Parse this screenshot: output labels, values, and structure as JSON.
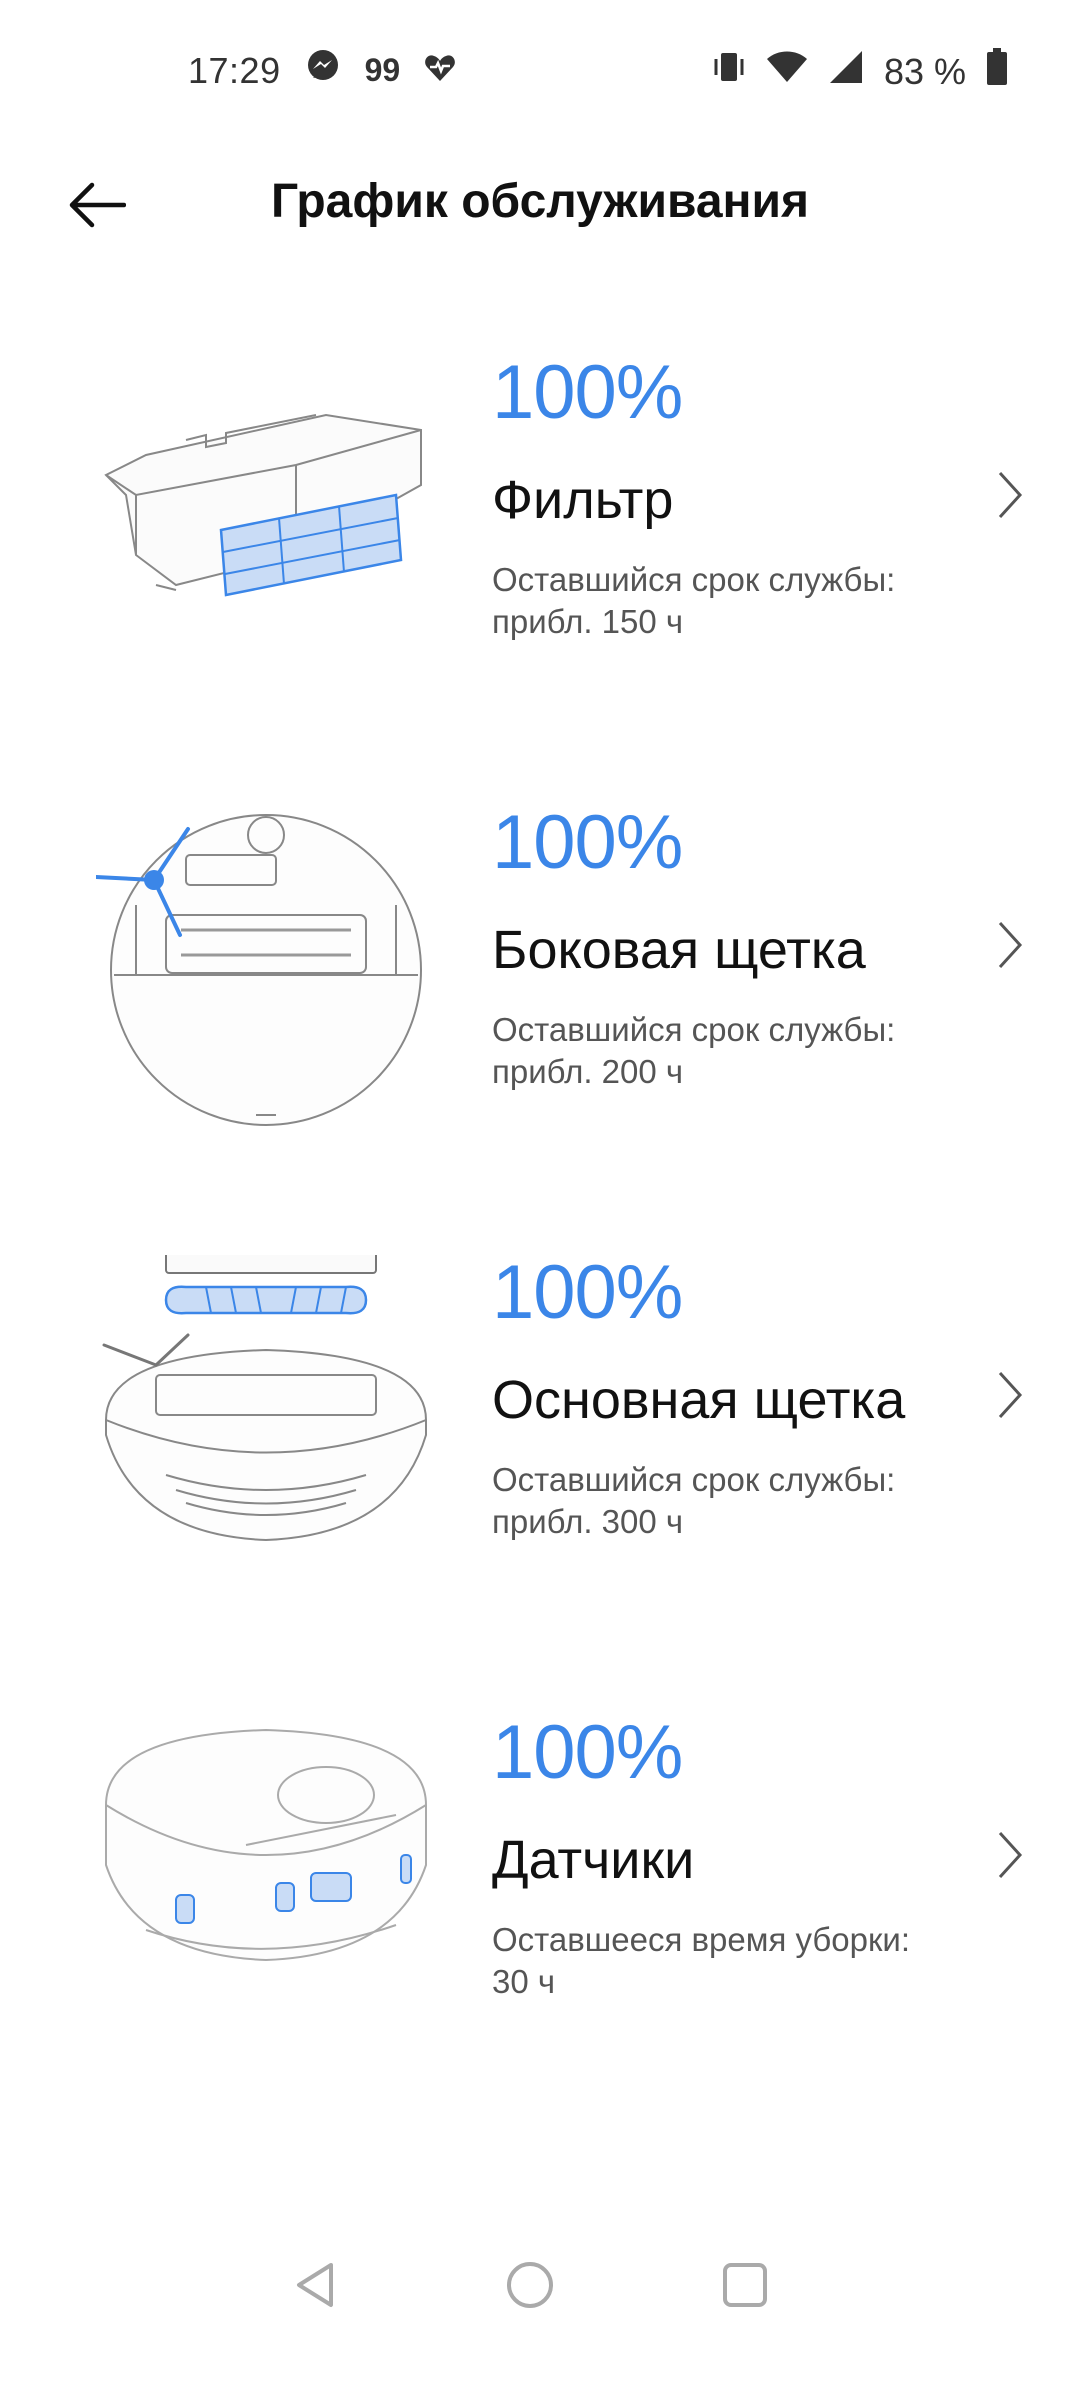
{
  "status_bar": {
    "time": "17:29",
    "messenger_icon": "messenger-icon",
    "notification_count": "99",
    "health_icon": "heart-pulse-icon",
    "vibrate_icon": "vibrate-icon",
    "wifi_icon": "wifi-icon",
    "signal_icon": "signal-icon",
    "battery_text": "83 %",
    "battery_icon": "battery-icon"
  },
  "header": {
    "back_icon": "arrow-left-icon",
    "title": "График обслуживания"
  },
  "items": [
    {
      "percent": "100%",
      "name": "Фильтр",
      "sub1": "Оставшийся срок службы:",
      "sub2": "прибл. 150 ч",
      "image": "filter-image"
    },
    {
      "percent": "100%",
      "name": "Боковая щетка",
      "sub1": "Оставшийся срок службы:",
      "sub2": "прибл. 200 ч",
      "image": "side-brush-image"
    },
    {
      "percent": "100%",
      "name": "Основная щетка",
      "sub1": "Оставшийся срок службы:",
      "sub2": "прибл. 300 ч",
      "image": "main-brush-image"
    },
    {
      "percent": "100%",
      "name": "Датчики",
      "sub1": "Оставшееся время уборки:",
      "sub2": "30 ч",
      "image": "sensors-image"
    }
  ],
  "nav_bar": {
    "back": "nav-back-icon",
    "home": "nav-home-icon",
    "recents": "nav-recents-icon"
  },
  "colors": {
    "accent": "#3b86e8",
    "text": "#111111",
    "secondary": "#555555"
  }
}
